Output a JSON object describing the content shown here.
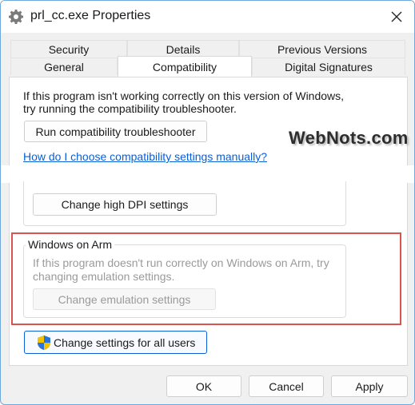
{
  "window": {
    "title": "prl_cc.exe Properties",
    "app_icon": "gear-app-icon",
    "close_icon": "close-icon"
  },
  "tabs": {
    "back_row": [
      "Security",
      "Details",
      "Previous Versions"
    ],
    "front_row": [
      "General",
      "Compatibility",
      "Digital Signatures"
    ],
    "active": "Compatibility"
  },
  "compat": {
    "intro_line1": "If this program isn't working correctly on this version of Windows,",
    "intro_line2": "try running the compatibility troubleshooter.",
    "run_troubleshooter": "Run compatibility troubleshooter",
    "manual_link": "How do I choose compatibility settings manually?",
    "watermark": "WebNots.com",
    "high_dpi_button": "Change high DPI settings"
  },
  "arm": {
    "group_title": "Windows on Arm",
    "desc_line1": "If this program doesn't run correctly on Windows on Arm, try",
    "desc_line2": "changing emulation settings.",
    "emulation_button": "Change emulation settings",
    "highlight_color": "#d9534f"
  },
  "all_users": {
    "button": "Change settings for all users",
    "icon": "uac-shield-icon"
  },
  "footer": {
    "ok": "OK",
    "cancel": "Cancel",
    "apply": "Apply"
  }
}
